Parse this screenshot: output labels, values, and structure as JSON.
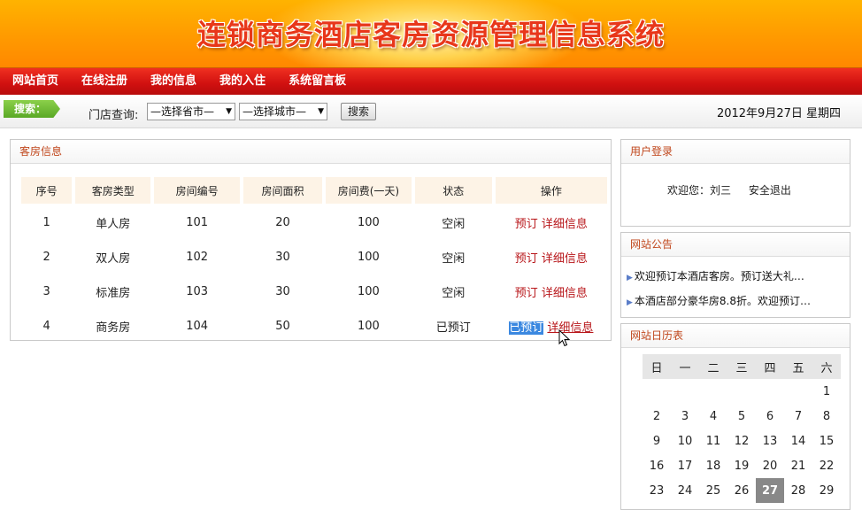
{
  "banner": {
    "title": "连锁商务酒店客房资源管理信息系统"
  },
  "nav": [
    "网站首页",
    "在线注册",
    "我的信息",
    "我的入住",
    "系统留言板"
  ],
  "search": {
    "tag": "搜索：",
    "store_label": "门店查询:",
    "province_select": "—选择省市—",
    "city_select": "—选择城市—",
    "button": "搜索",
    "date": "2012年9月27日 星期四"
  },
  "rooms": {
    "title": "客房信息",
    "headers": [
      "序号",
      "客房类型",
      "房间编号",
      "房间面积",
      "房间费(一天)",
      "状态",
      "操作"
    ],
    "rows": [
      {
        "no": "1",
        "type": "单人房",
        "room": "101",
        "area": "20",
        "fee": "100",
        "status": "空闲",
        "action": "预订",
        "detail": "详细信息"
      },
      {
        "no": "2",
        "type": "双人房",
        "room": "102",
        "area": "30",
        "fee": "100",
        "status": "空闲",
        "action": "预订",
        "detail": "详细信息"
      },
      {
        "no": "3",
        "type": "标准房",
        "room": "103",
        "area": "30",
        "fee": "100",
        "status": "空闲",
        "action": "预订",
        "detail": "详细信息"
      },
      {
        "no": "4",
        "type": "商务房",
        "room": "104",
        "area": "50",
        "fee": "100",
        "status": "已预订",
        "action": "已预订",
        "detail": "详细信息"
      }
    ]
  },
  "login": {
    "title": "用户登录",
    "welcome": "欢迎您：刘三",
    "logout": "安全退出"
  },
  "notices": {
    "title": "网站公告",
    "items": [
      "欢迎预订本酒店客房。预订送大礼…",
      "本酒店部分豪华房8.8折。欢迎预订…"
    ]
  },
  "calendar": {
    "title": "网站日历表",
    "weekdays": [
      "日",
      "一",
      "二",
      "三",
      "四",
      "五",
      "六"
    ],
    "weeks": [
      [
        "",
        "",
        "",
        "",
        "",
        "",
        "1"
      ],
      [
        "2",
        "3",
        "4",
        "5",
        "6",
        "7",
        "8"
      ],
      [
        "9",
        "10",
        "11",
        "12",
        "13",
        "14",
        "15"
      ],
      [
        "16",
        "17",
        "18",
        "19",
        "20",
        "21",
        "22"
      ],
      [
        "23",
        "24",
        "25",
        "26",
        "27",
        "28",
        "29"
      ]
    ],
    "today": "27"
  },
  "colors": {
    "nav_red": "#d01010",
    "accent_orange": "#ff9a00",
    "link_red": "#b8161a",
    "header_text": "#c0461b"
  }
}
